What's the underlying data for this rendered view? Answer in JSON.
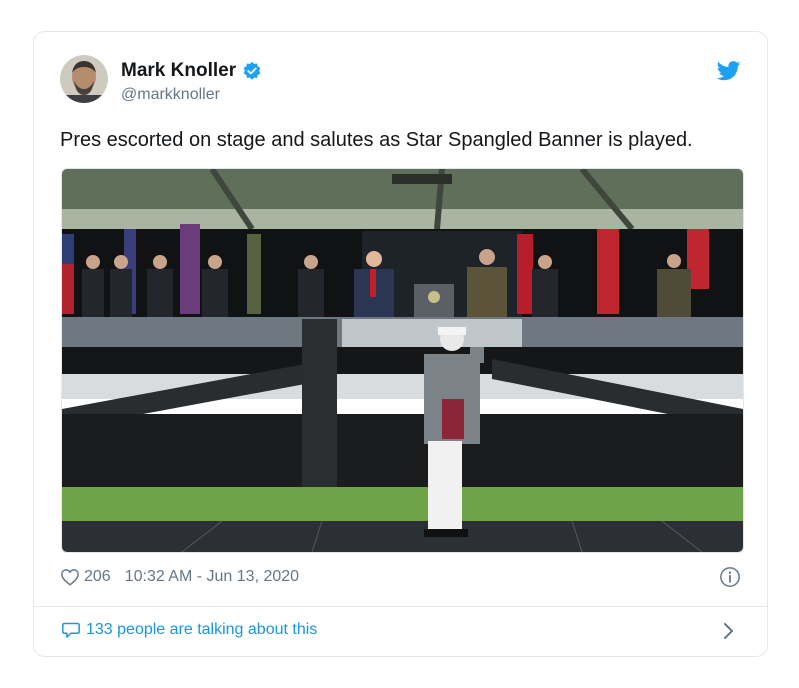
{
  "author": {
    "name": "Mark Knoller",
    "handle": "@markknoller",
    "verified": true
  },
  "tweet": {
    "text": "Pres escorted on stage and salutes as Star Spangled Banner is played."
  },
  "footer": {
    "likes": "206",
    "timestamp": "10:32 AM - Jun 13, 2020",
    "talking": "133 people are talking about this"
  },
  "colors": {
    "accent": "#1b95e0",
    "muted": "#657786",
    "verified": "#1da1f2",
    "border": "#e1e8ed"
  },
  "icons": [
    "twitter-bird-icon",
    "verified-badge-icon",
    "heart-icon",
    "info-icon",
    "speech-bubble-icon",
    "chevron-right-icon"
  ]
}
